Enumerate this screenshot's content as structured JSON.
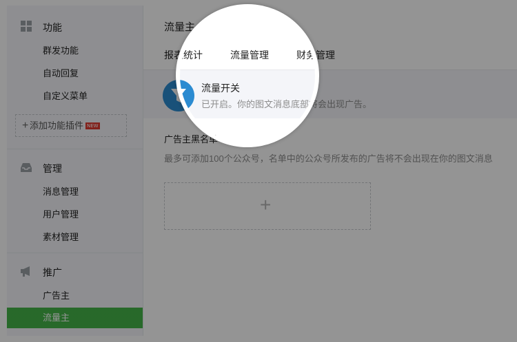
{
  "sidebar": {
    "sections": [
      {
        "label": "功能",
        "icon": "grid-icon",
        "items": [
          "群发功能",
          "自动回复",
          "自定义菜单"
        ]
      },
      {
        "label": "管理",
        "icon": "inbox-icon",
        "items": [
          "消息管理",
          "用户管理",
          "素材管理"
        ]
      },
      {
        "label": "推广",
        "icon": "megaphone-icon",
        "items": [
          "广告主",
          "流量主"
        ]
      }
    ],
    "add_plugin": {
      "label": "添加功能插件",
      "badge": "NEW"
    },
    "active_item": "流量主"
  },
  "main": {
    "title": "流量主",
    "tabs": [
      {
        "label": "报表统计",
        "active": false
      },
      {
        "label": "流量管理",
        "active": true
      },
      {
        "label": "财务管理",
        "active": false
      }
    ],
    "status": {
      "title": "流量开关",
      "desc": "已开启。你的图文消息底部将会出现广告。",
      "icon": "funnel-icon"
    },
    "blacklist": {
      "title": "广告主黑名单",
      "desc": "最多可添加100个公众号，名单中的公众号所发布的广告将不会出现在你的图文消息",
      "add_icon": "plus-icon"
    }
  },
  "colors": {
    "accent": "#44b549",
    "status_icon": "#2b8bd1",
    "badge": "#e0382f"
  }
}
